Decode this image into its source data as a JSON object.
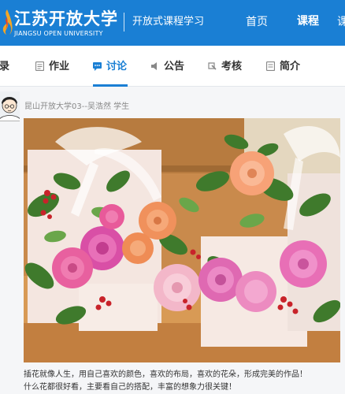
{
  "header": {
    "logo_cn": "江苏开放大学",
    "logo_en": "JIANGSU OPEN UNIVERSITY",
    "slogan": "开放式课程学习",
    "nav": {
      "home": "首页",
      "course": "课程",
      "more": "课"
    }
  },
  "tabs": [
    {
      "label": "录",
      "icon": "record-icon"
    },
    {
      "label": "作业",
      "icon": "homework-icon"
    },
    {
      "label": "讨论",
      "icon": "discussion-icon",
      "active": true
    },
    {
      "label": "公告",
      "icon": "announcement-icon"
    },
    {
      "label": "考核",
      "icon": "assessment-icon"
    },
    {
      "label": "简介",
      "icon": "intro-icon"
    }
  ],
  "post": {
    "author": "昆山开放大学03--吴浩然 学生",
    "caption_line1": "插花就像人生，用自己喜欢的颜色，喜欢的布局，喜欢的花朵，形成完美的作品！",
    "caption_line2": "什么花都很好看，主要看自己的搭配，丰富的想象力很关键！"
  },
  "colors": {
    "brand": "#1a7fd4",
    "text": "#333333",
    "muted": "#888888"
  }
}
